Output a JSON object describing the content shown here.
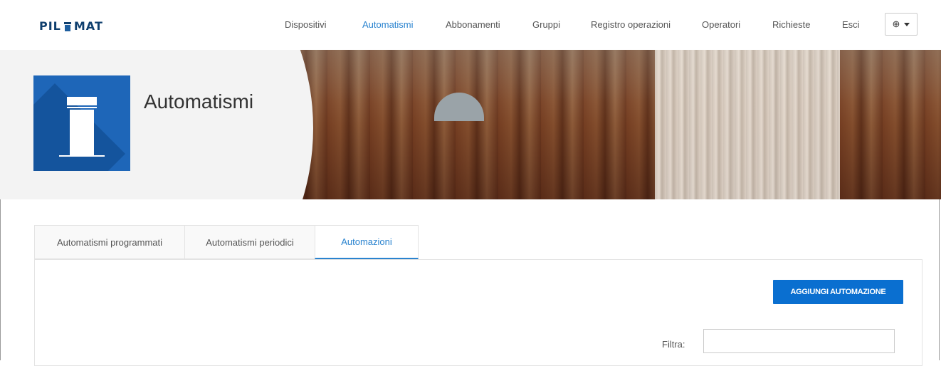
{
  "brand": {
    "logo_left": "PIL",
    "logo_right": "MAT"
  },
  "nav": {
    "items": [
      {
        "label": "Dispositivi",
        "active": false
      },
      {
        "label": "Automatismi",
        "active": true
      },
      {
        "label": "Abbonamenti",
        "active": false
      },
      {
        "label": "Gruppi",
        "active": false
      },
      {
        "label": "Registro operazioni",
        "active": false
      },
      {
        "label": "Operatori",
        "active": false
      },
      {
        "label": "Richieste",
        "active": false
      },
      {
        "label": "Esci",
        "active": false
      }
    ],
    "language_icon": "globe-icon"
  },
  "header": {
    "title": "Automatismi",
    "icon": "bollard-icon"
  },
  "tabs": [
    {
      "label": "Automatismi programmati",
      "active": false
    },
    {
      "label": "Automatismi periodici",
      "active": false
    },
    {
      "label": "Automazioni",
      "active": true
    }
  ],
  "actions": {
    "add_label": "AGGIUNGI AUTOMAZIONE"
  },
  "filter": {
    "label": "Filtra:",
    "value": "",
    "placeholder": ""
  },
  "colors": {
    "accent": "#2a83cf",
    "button": "#0a6fd0",
    "tile": "#1e66b8",
    "logo": "#0f3f6e"
  }
}
